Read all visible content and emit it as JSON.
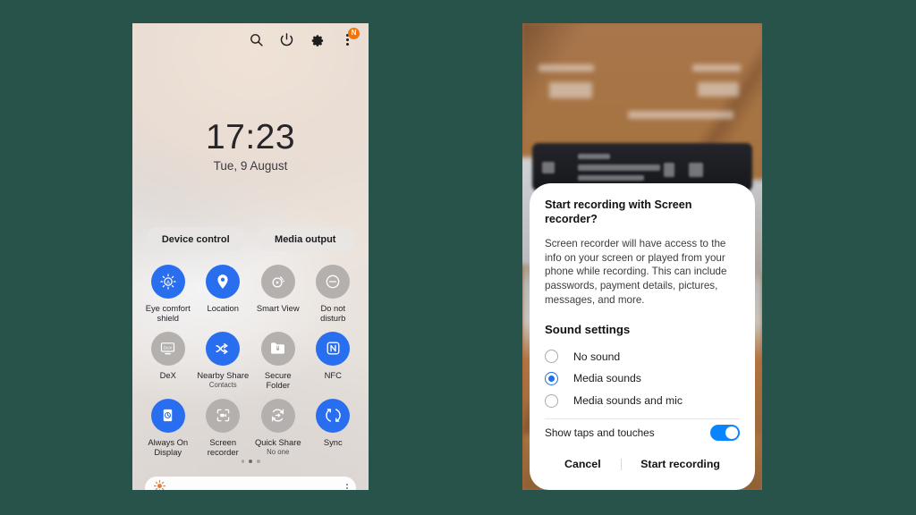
{
  "background_color": "#27534a",
  "left_phone": {
    "name": "quick-settings-panel",
    "statusbar": {
      "icons": [
        "search-icon",
        "power-icon",
        "gear-icon",
        "more-options-icon"
      ],
      "badge_label": "N",
      "badge_color": "#f2740d"
    },
    "clock": {
      "time": "17:23",
      "date": "Tue, 9 August"
    },
    "pills": [
      {
        "label": "Device control"
      },
      {
        "label": "Media output"
      }
    ],
    "tiles": [
      {
        "label": "Eye comfort shield",
        "sub": "",
        "state": "on",
        "icon": "eye-comfort-shield-icon"
      },
      {
        "label": "Location",
        "sub": "",
        "state": "on",
        "icon": "location-pin-icon"
      },
      {
        "label": "Smart View",
        "sub": "",
        "state": "off",
        "icon": "smart-view-icon"
      },
      {
        "label": "Do not disturb",
        "sub": "",
        "state": "off",
        "icon": "do-not-disturb-icon"
      },
      {
        "label": "DeX",
        "sub": "",
        "state": "off",
        "icon": "dex-icon"
      },
      {
        "label": "Nearby Share",
        "sub": "Contacts",
        "state": "on",
        "icon": "nearby-share-icon"
      },
      {
        "label": "Secure Folder",
        "sub": "",
        "state": "off",
        "icon": "secure-folder-icon"
      },
      {
        "label": "NFC",
        "sub": "",
        "state": "on",
        "icon": "nfc-icon"
      },
      {
        "label": "Always On Display",
        "sub": "",
        "state": "on",
        "icon": "always-on-display-icon"
      },
      {
        "label": "Screen recorder",
        "sub": "",
        "state": "off",
        "icon": "screen-recorder-icon"
      },
      {
        "label": "Quick Share",
        "sub": "No one",
        "state": "off",
        "icon": "quick-share-icon"
      },
      {
        "label": "Sync",
        "sub": "",
        "state": "on",
        "icon": "sync-icon"
      }
    ],
    "page_dots": {
      "count": 3,
      "active_index": 1
    },
    "brightness": {
      "icon": "brightness-sun-icon",
      "value_percent": 2,
      "more_icon": "more-options-icon"
    },
    "accent_on_color": "#2a6ef0",
    "accent_off_color": "#b4b0ae"
  },
  "right_phone": {
    "name": "screen-recorder-permission-dialog",
    "dialog": {
      "title": "Start recording with Screen recorder?",
      "body": "Screen recorder will have access to the info on your screen or played from your phone while recording. This can include passwords, payment details, pictures, messages, and more.",
      "section_heading": "Sound settings",
      "options": [
        {
          "label": "No sound",
          "selected": false
        },
        {
          "label": "Media sounds",
          "selected": true
        },
        {
          "label": "Media sounds and mic",
          "selected": false
        }
      ],
      "toggle": {
        "label": "Show taps and touches",
        "on": true,
        "color": "#0a84ff"
      },
      "actions": {
        "cancel": "Cancel",
        "confirm": "Start recording"
      },
      "radio_selected_color": "#1a73e8"
    }
  }
}
